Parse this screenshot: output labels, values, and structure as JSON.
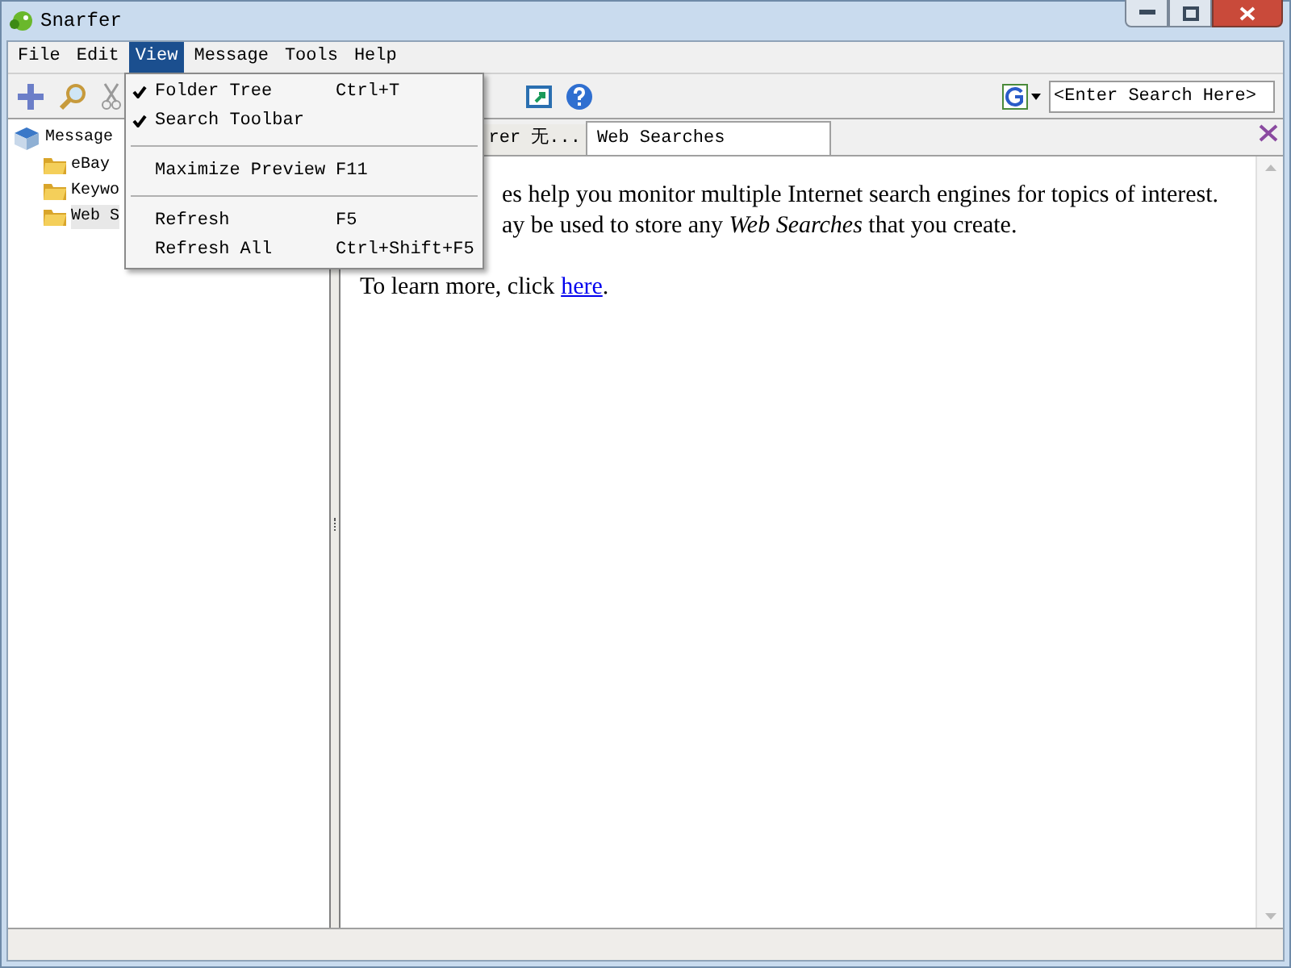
{
  "window": {
    "title": "Snarfer"
  },
  "menubar": [
    {
      "label": "File",
      "selected": false
    },
    {
      "label": "Edit",
      "selected": false
    },
    {
      "label": "View",
      "selected": true
    },
    {
      "label": "Message",
      "selected": false
    },
    {
      "label": "Tools",
      "selected": false
    },
    {
      "label": "Help",
      "selected": false
    }
  ],
  "view_menu": [
    {
      "kind": "item",
      "label": "Folder Tree",
      "shortcut": "Ctrl+T",
      "checked": true
    },
    {
      "kind": "item",
      "label": "Search Toolbar",
      "checked": true
    },
    {
      "kind": "separator"
    },
    {
      "kind": "item",
      "label": "Maximize Preview",
      "shortcut": "F11",
      "checked": false
    },
    {
      "kind": "separator"
    },
    {
      "kind": "item",
      "label": "Refresh",
      "shortcut": "F5",
      "checked": false
    },
    {
      "kind": "item",
      "label": "Refresh All",
      "shortcut": "Ctrl+Shift+F5",
      "checked": false
    }
  ],
  "search": {
    "placeholder": "<Enter Search Here>"
  },
  "folder_tree": [
    {
      "label": "Message",
      "children": [
        {
          "label": "eBay",
          "selected": false
        },
        {
          "label": "Keywo",
          "selected": false
        },
        {
          "label": "Web S",
          "selected": true
        }
      ]
    }
  ],
  "tabs": [
    {
      "label": "rer 无...",
      "selected": false
    },
    {
      "label": "Web Searches",
      "selected": true
    }
  ],
  "content": {
    "line_1": "es help you monitor multiple Internet search engines for topics of interest.",
    "line_2": "ay be used to store any *Web Searches* that you create.",
    "learn_more": "To learn more, click",
    "link": "here",
    "link_end": "."
  }
}
